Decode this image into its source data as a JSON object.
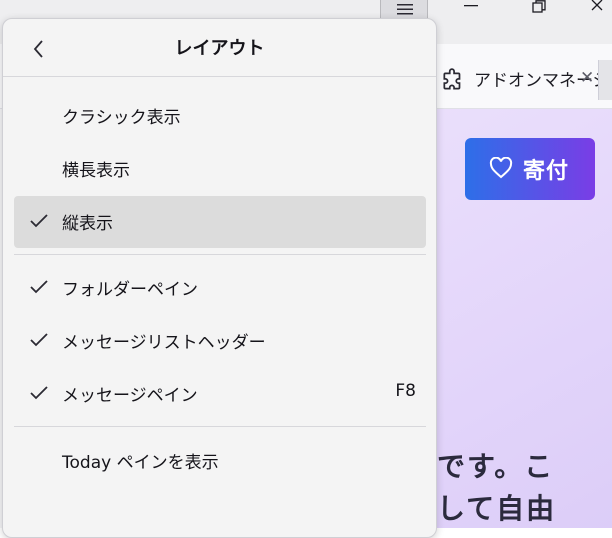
{
  "background": {
    "addon_tab_label": "アドオンマネージ",
    "donate_label": "寄付",
    "content_text_line1": "です。こ",
    "content_text_line2": "して自由"
  },
  "panel": {
    "title": "レイアウト",
    "items": [
      {
        "label": "クラシック表示",
        "checked": false,
        "shortcut": ""
      },
      {
        "label": "横長表示",
        "checked": false,
        "shortcut": ""
      },
      {
        "label": "縦表示",
        "checked": true,
        "shortcut": ""
      },
      {
        "label": "フォルダーペイン",
        "checked": true,
        "shortcut": ""
      },
      {
        "label": "メッセージリストヘッダー",
        "checked": true,
        "shortcut": ""
      },
      {
        "label": "メッセージペイン",
        "checked": true,
        "shortcut": "F8"
      },
      {
        "label": "Today ペインを表示",
        "checked": false,
        "shortcut": ""
      }
    ]
  },
  "colors": {
    "accent_gradient_start": "#2d6fe8",
    "accent_gradient_end": "#7a3de6",
    "selected_row": "#dcdcdc",
    "panel_bg": "#f4f4f4"
  }
}
